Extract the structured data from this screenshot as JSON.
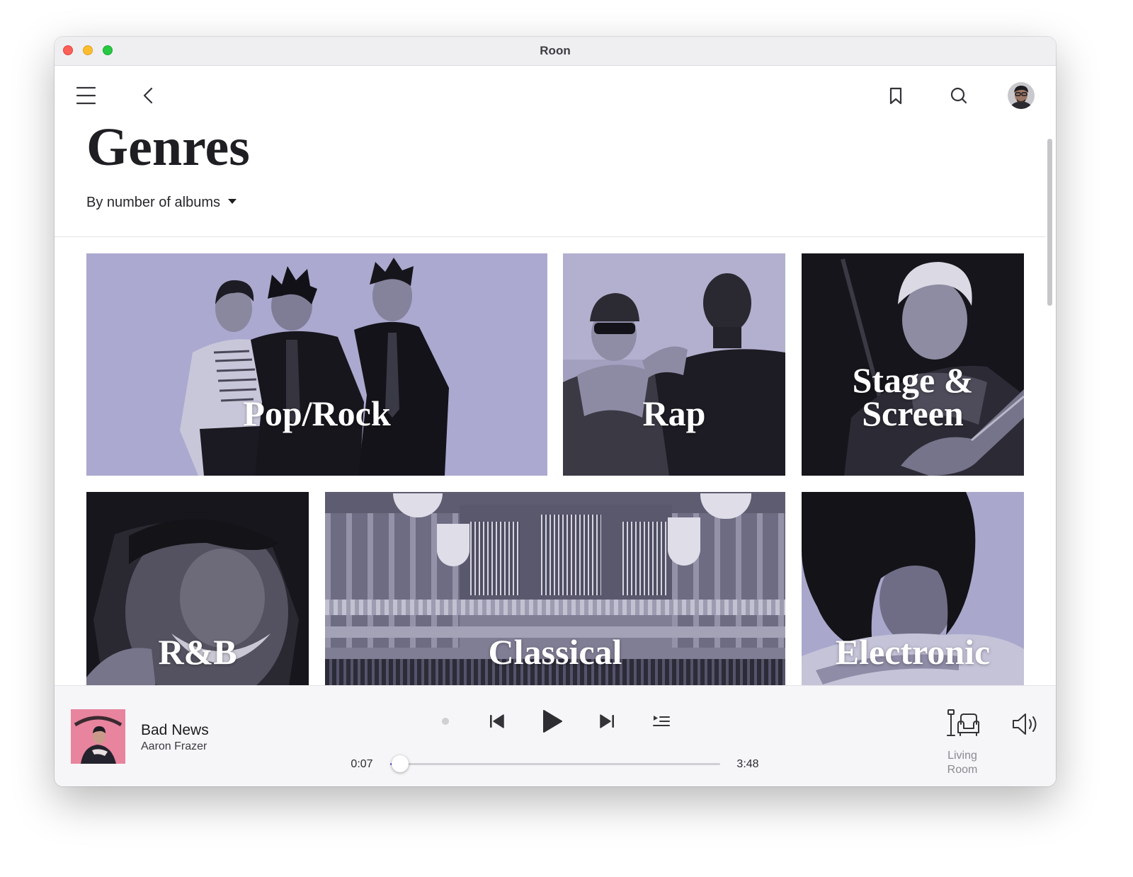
{
  "window": {
    "title": "Roon"
  },
  "header": {
    "menu_icon": "menu-icon",
    "back_icon": "chevron-left-icon",
    "bookmark_icon": "bookmark-icon",
    "search_icon": "search-icon",
    "avatar_icon": "user-avatar"
  },
  "page": {
    "title": "Genres",
    "sort_label": "By number of albums",
    "sort_icon": "caret-down-icon"
  },
  "genres": [
    {
      "label": "Pop/Rock"
    },
    {
      "label": "Rap"
    },
    {
      "label": "Stage & Screen"
    },
    {
      "label": "R&B"
    },
    {
      "label": "Classical"
    },
    {
      "label": "Electronic"
    }
  ],
  "now_playing": {
    "title": "Bad News",
    "artist": "Aaron Frazer",
    "elapsed": "0:07",
    "duration": "3:48",
    "progress": 0.031
  },
  "transport": {
    "icons": [
      "status-dot-icon",
      "previous-icon",
      "play-icon",
      "next-icon",
      "queue-icon"
    ]
  },
  "zone": {
    "name": "Living Room",
    "icon": "zone-lamp-armchair-icon"
  },
  "volume": {
    "icon": "speaker-volume-icon"
  },
  "colors": {
    "accent": "#5b5bd6",
    "tile_label": "#ffffff",
    "player_bg": "#f6f6f8"
  }
}
